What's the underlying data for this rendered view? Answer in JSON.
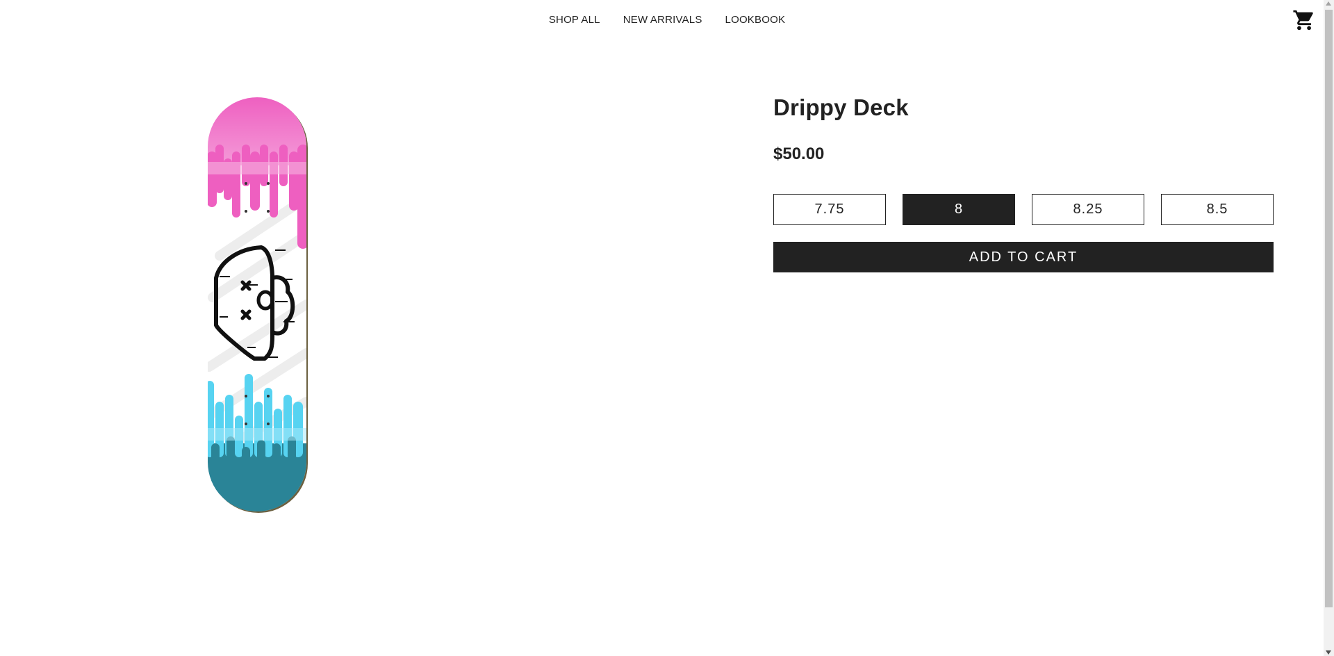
{
  "nav": {
    "links": [
      "SHOP ALL",
      "NEW ARRIVALS",
      "LOOKBOOK"
    ],
    "cart_icon": "shopping-cart-icon"
  },
  "product": {
    "title": "Drippy Deck",
    "price": "$50.00",
    "sizes": [
      "7.75",
      "8",
      "8.25",
      "8.5"
    ],
    "selected_size": "8",
    "add_to_cart_label": "ADD TO CART",
    "image": {
      "icon": "skateboard-deck-image",
      "colors": {
        "top_drip": "#f06ac4",
        "bottom_drip": "#54d4f2",
        "bottom_dark": "#2a8599",
        "face_outline": "#111111"
      }
    }
  },
  "colors": {
    "primary": "#222222",
    "background": "#ffffff"
  }
}
